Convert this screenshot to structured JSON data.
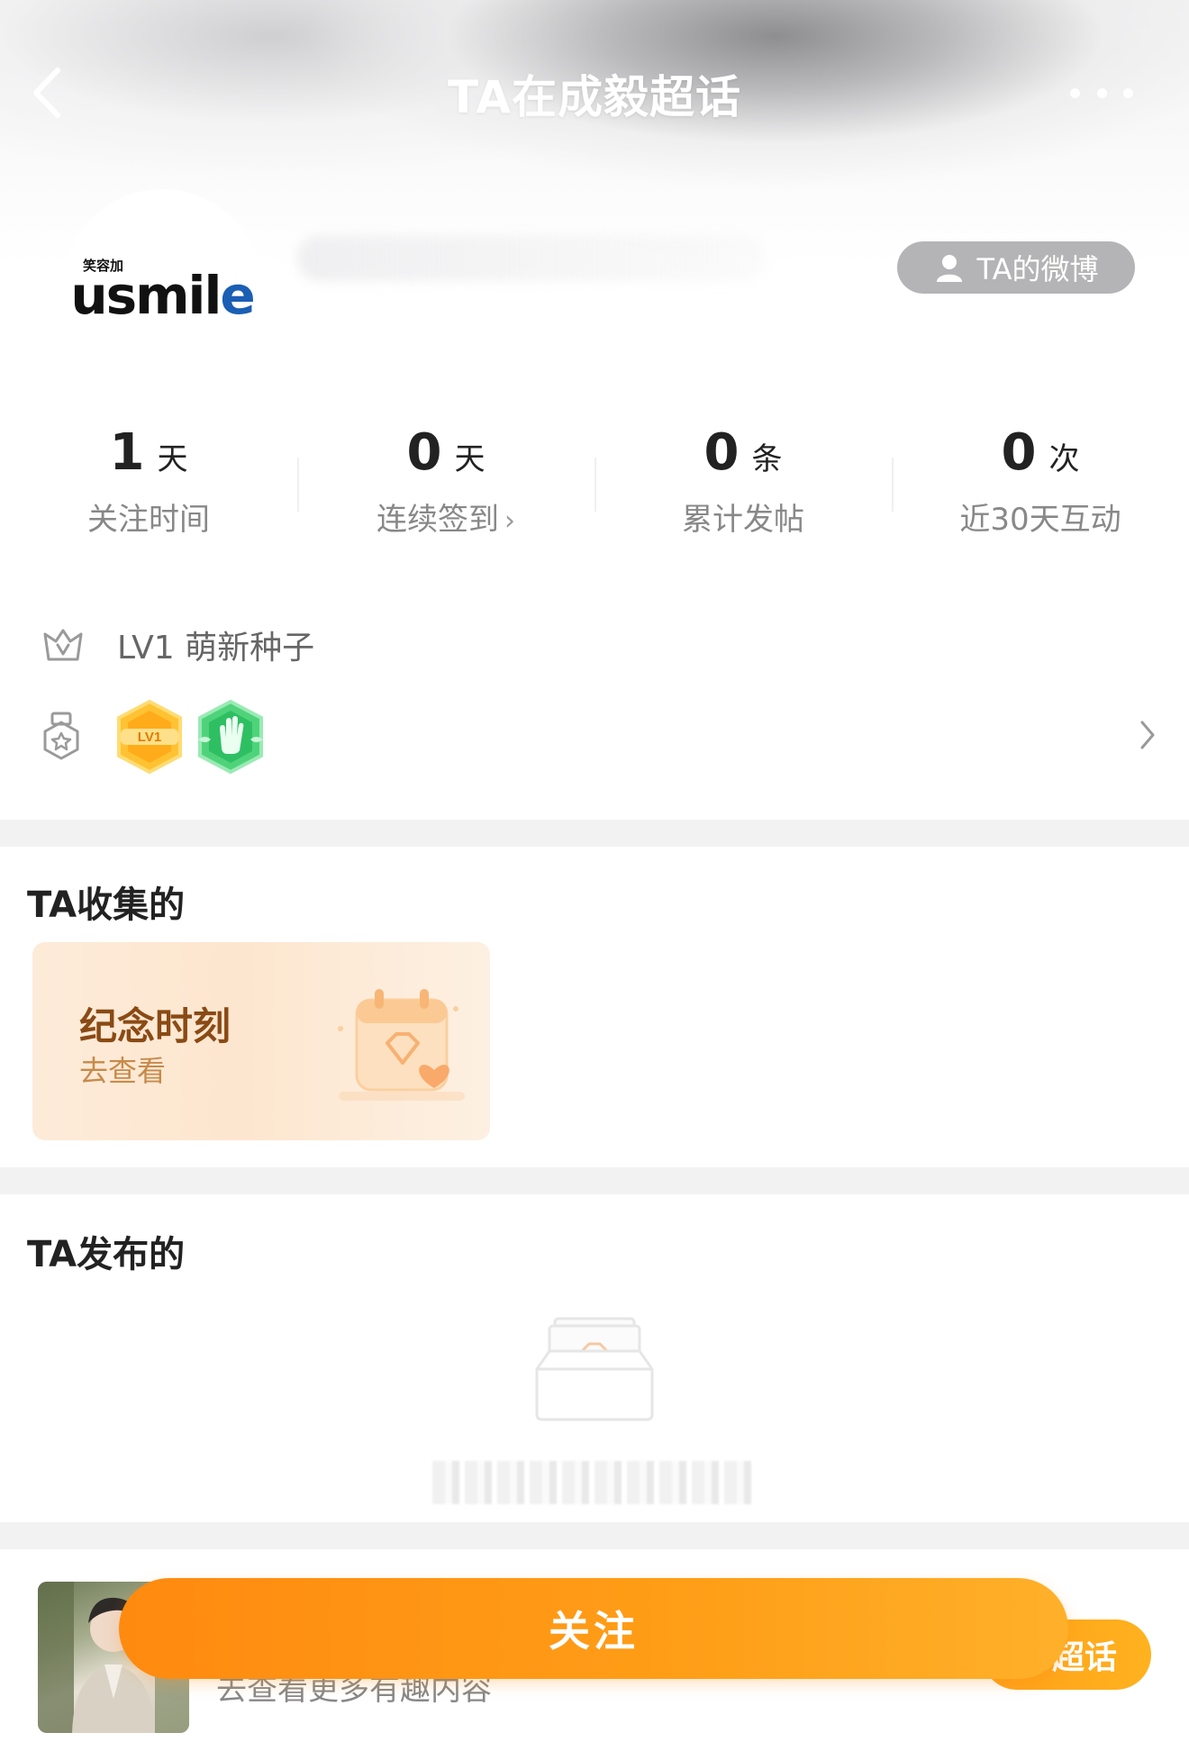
{
  "header": {
    "title": "TA在成毅超话",
    "weibo_button_label": "TA的微博"
  },
  "profile": {
    "logo_small": "笑容加",
    "logo_main_prefix": "usmil",
    "logo_main_suffix": "e"
  },
  "stats": [
    {
      "value": "1",
      "unit": "天",
      "label": "关注时间",
      "chevron": ""
    },
    {
      "value": "0",
      "unit": "天",
      "label": "连续签到",
      "chevron": "›"
    },
    {
      "value": "0",
      "unit": "条",
      "label": "累计发帖",
      "chevron": ""
    },
    {
      "value": "0",
      "unit": "次",
      "label": "近30天互动",
      "chevron": ""
    }
  ],
  "level": {
    "text": "LV1 萌新种子",
    "badge1_text": "LV1"
  },
  "sections": {
    "collected_title": "TA收集的",
    "posted_title": "TA发布的"
  },
  "memorial_card": {
    "title": "纪念时刻",
    "subtitle": "去查看"
  },
  "bottom": {
    "subtitle": "去查看更多有趣内容",
    "super_topic_button": "超话",
    "follow_button": "关注"
  },
  "colors": {
    "accent": "#FF9A16",
    "card_title": "#8A4A14",
    "card_sub": "#C78A4A",
    "weibo_button_bg": "#B4B4B6"
  },
  "icons": {
    "back": "chevron-left-icon",
    "more": "more-dots-icon",
    "user": "user-icon",
    "crown": "crown-icon",
    "medal": "medal-icon",
    "chevron": "chevron-right-icon"
  }
}
